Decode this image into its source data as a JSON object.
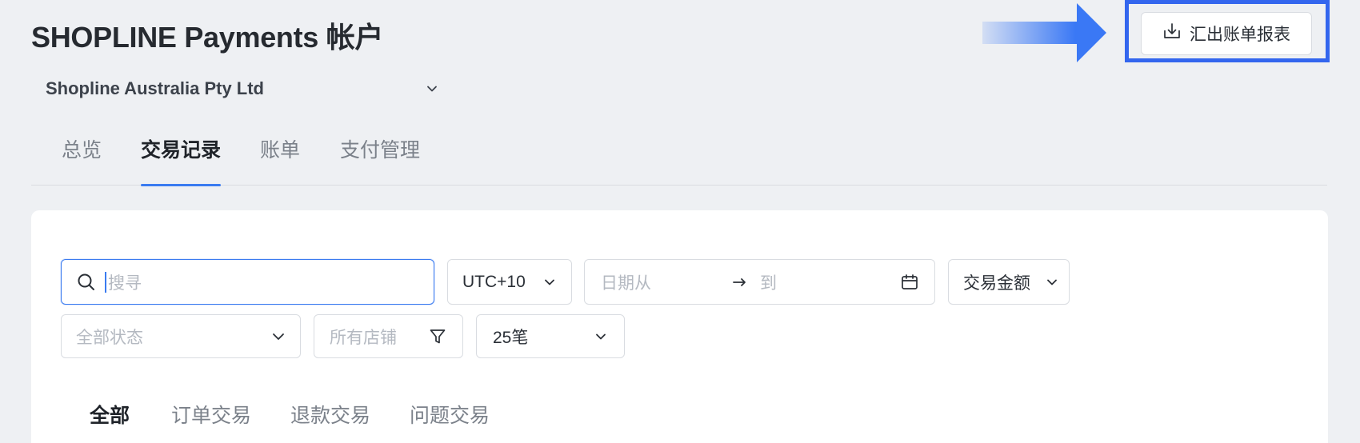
{
  "header": {
    "title": "SHOPLINE Payments 帐户",
    "account": "Shopline Australia Pty Ltd",
    "export_label": "汇出账单报表"
  },
  "tabs": [
    {
      "label": "总览",
      "active": false
    },
    {
      "label": "交易记录",
      "active": true
    },
    {
      "label": "账单",
      "active": false
    },
    {
      "label": "支付管理",
      "active": false
    }
  ],
  "filters": {
    "search_placeholder": "搜寻",
    "timezone": "UTC+10",
    "date_from_placeholder": "日期从",
    "date_to_placeholder": "到",
    "amount_label": "交易金额",
    "status_placeholder": "全部状态",
    "store_placeholder": "所有店铺",
    "page_size": "25笔"
  },
  "subtabs": [
    {
      "label": "全部",
      "active": true
    },
    {
      "label": "订单交易",
      "active": false
    },
    {
      "label": "退款交易",
      "active": false
    },
    {
      "label": "问题交易",
      "active": false
    }
  ],
  "colors": {
    "accent": "#3a7bf0",
    "highlight_frame": "#3366ee",
    "background": "#eef0f3"
  }
}
